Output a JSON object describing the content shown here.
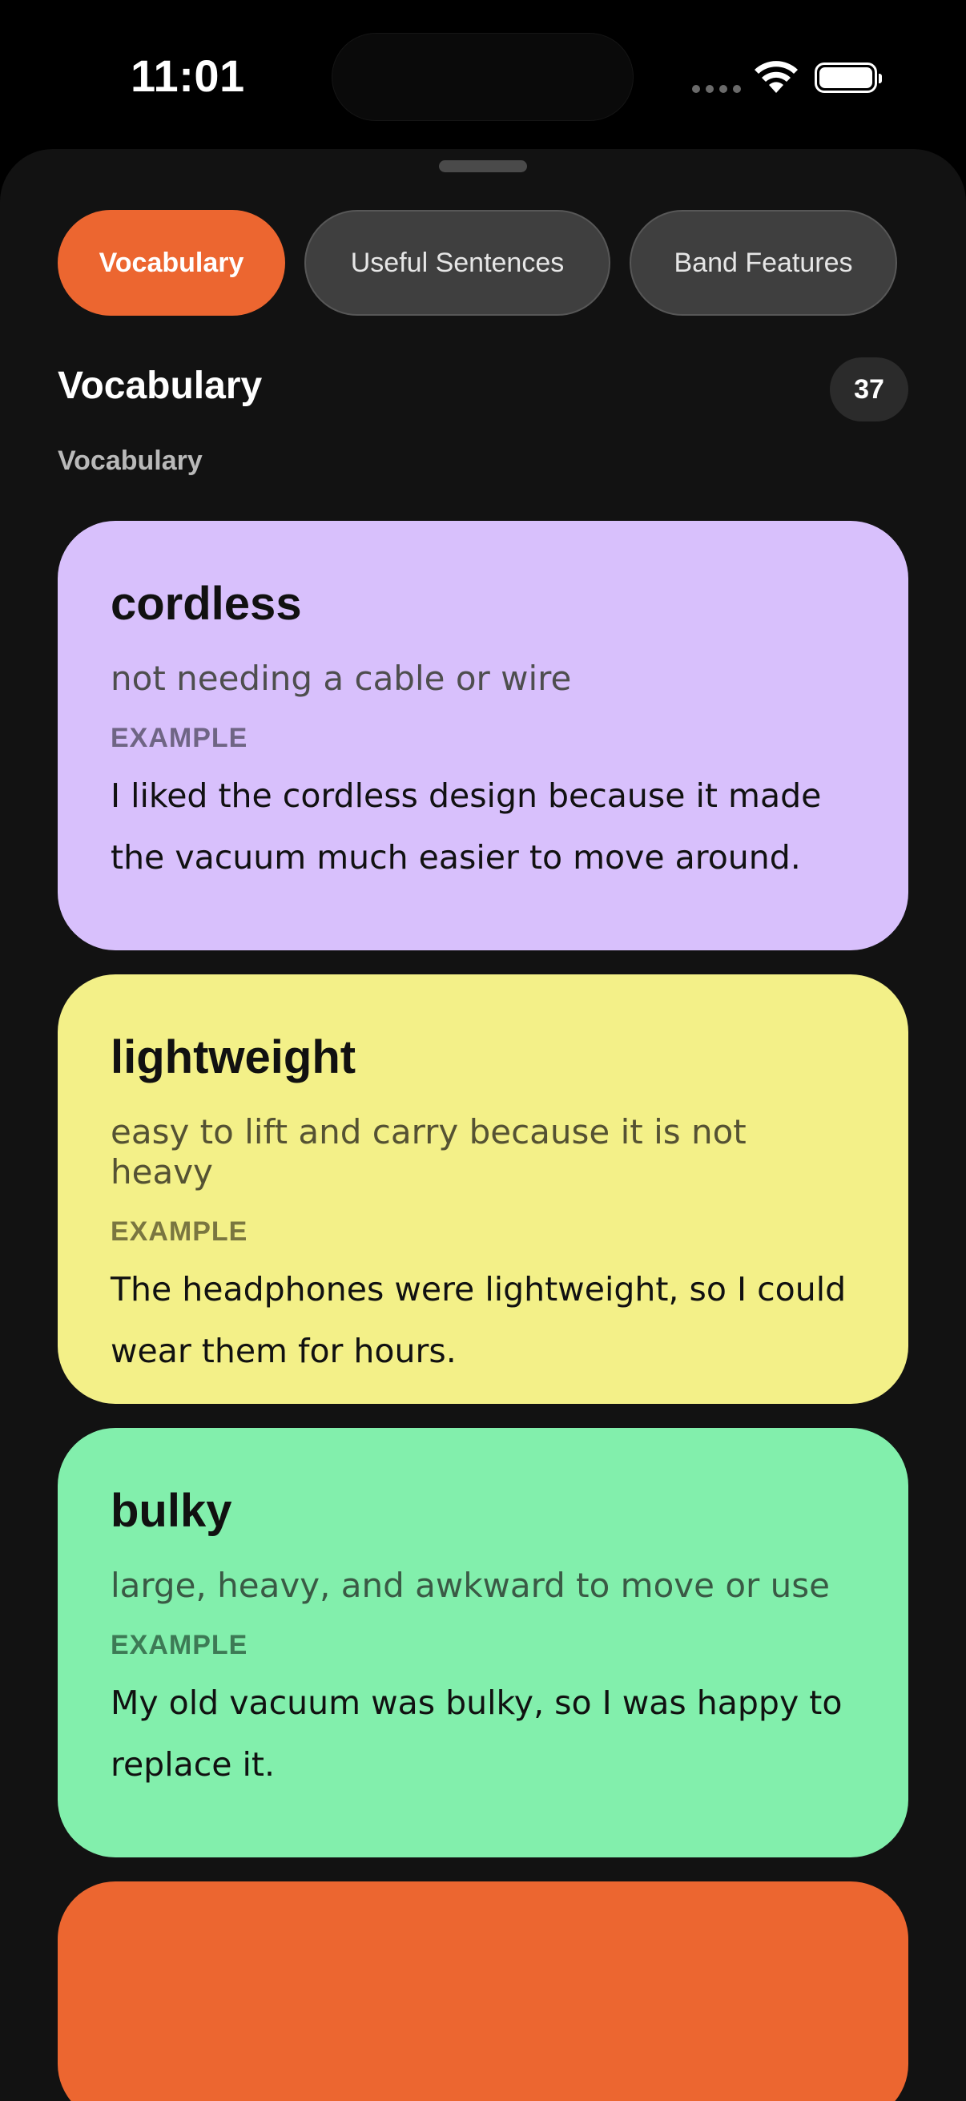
{
  "status_bar": {
    "time": "11:01"
  },
  "tabs": [
    {
      "label": "Vocabulary",
      "active": true
    },
    {
      "label": "Useful Sentences",
      "active": false
    },
    {
      "label": "Band Features",
      "active": false
    }
  ],
  "section": {
    "title": "Vocabulary",
    "count": "37",
    "subtitle": "Vocabulary"
  },
  "cards": [
    {
      "word": "cordless",
      "definition": "not needing a cable or wire",
      "example_label": "EXAMPLE",
      "example": "I liked the cordless design because it made the vacuum much easier to move around.",
      "color": "#d8c0fc"
    },
    {
      "word": "lightweight",
      "definition": "easy to lift and carry because it is not heavy",
      "example_label": "EXAMPLE",
      "example": "The headphones were lightweight, so I could wear them for hours.",
      "color": "#f3f088"
    },
    {
      "word": "bulky",
      "definition": "large, heavy, and awkward to move or use",
      "example_label": "EXAMPLE",
      "example": "My old vacuum was bulky, so I was happy to replace it.",
      "color": "#82efac"
    },
    {
      "color": "#ec6630"
    }
  ],
  "colors": {
    "accent": "#ec6630",
    "background": "#121212"
  },
  "icons": [
    "signal-icon",
    "wifi-icon",
    "battery-icon"
  ]
}
